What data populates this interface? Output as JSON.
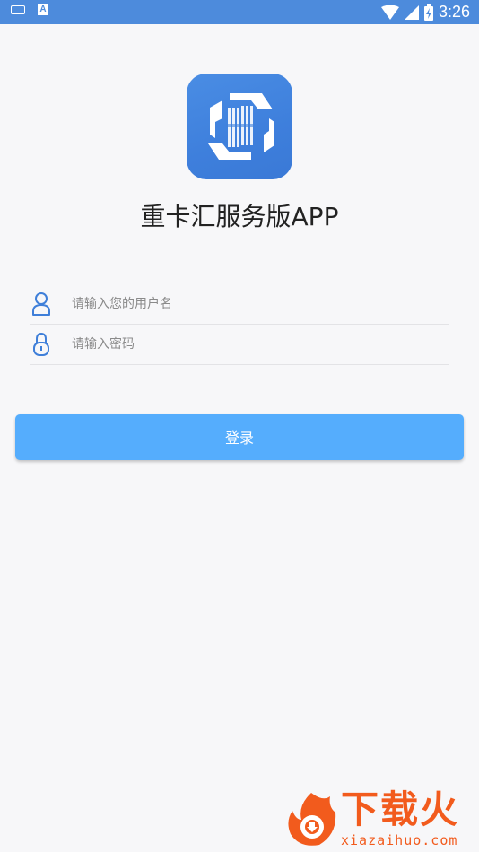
{
  "status_bar": {
    "time": "3:26",
    "left_icons": [
      "keyboard-icon",
      "a-notification-icon"
    ],
    "right_icons": [
      "wifi-icon",
      "cell-signal-icon",
      "battery-icon"
    ],
    "color": "#4d8bdc"
  },
  "app": {
    "title": "重卡汇服务版APP",
    "logo_icon": "app-logo-icon",
    "logo_color": "#3f80dc"
  },
  "form": {
    "username": {
      "placeholder": "请输入您的用户名",
      "value": "",
      "icon": "user-icon"
    },
    "password": {
      "placeholder": "请输入密码",
      "value": "",
      "icon": "lock-icon"
    }
  },
  "login_button": {
    "label": "登录",
    "color": "#55adfd"
  },
  "watermark": {
    "text": "下载火",
    "url": "xiazaihuo.com",
    "color": "#f25b1d"
  }
}
